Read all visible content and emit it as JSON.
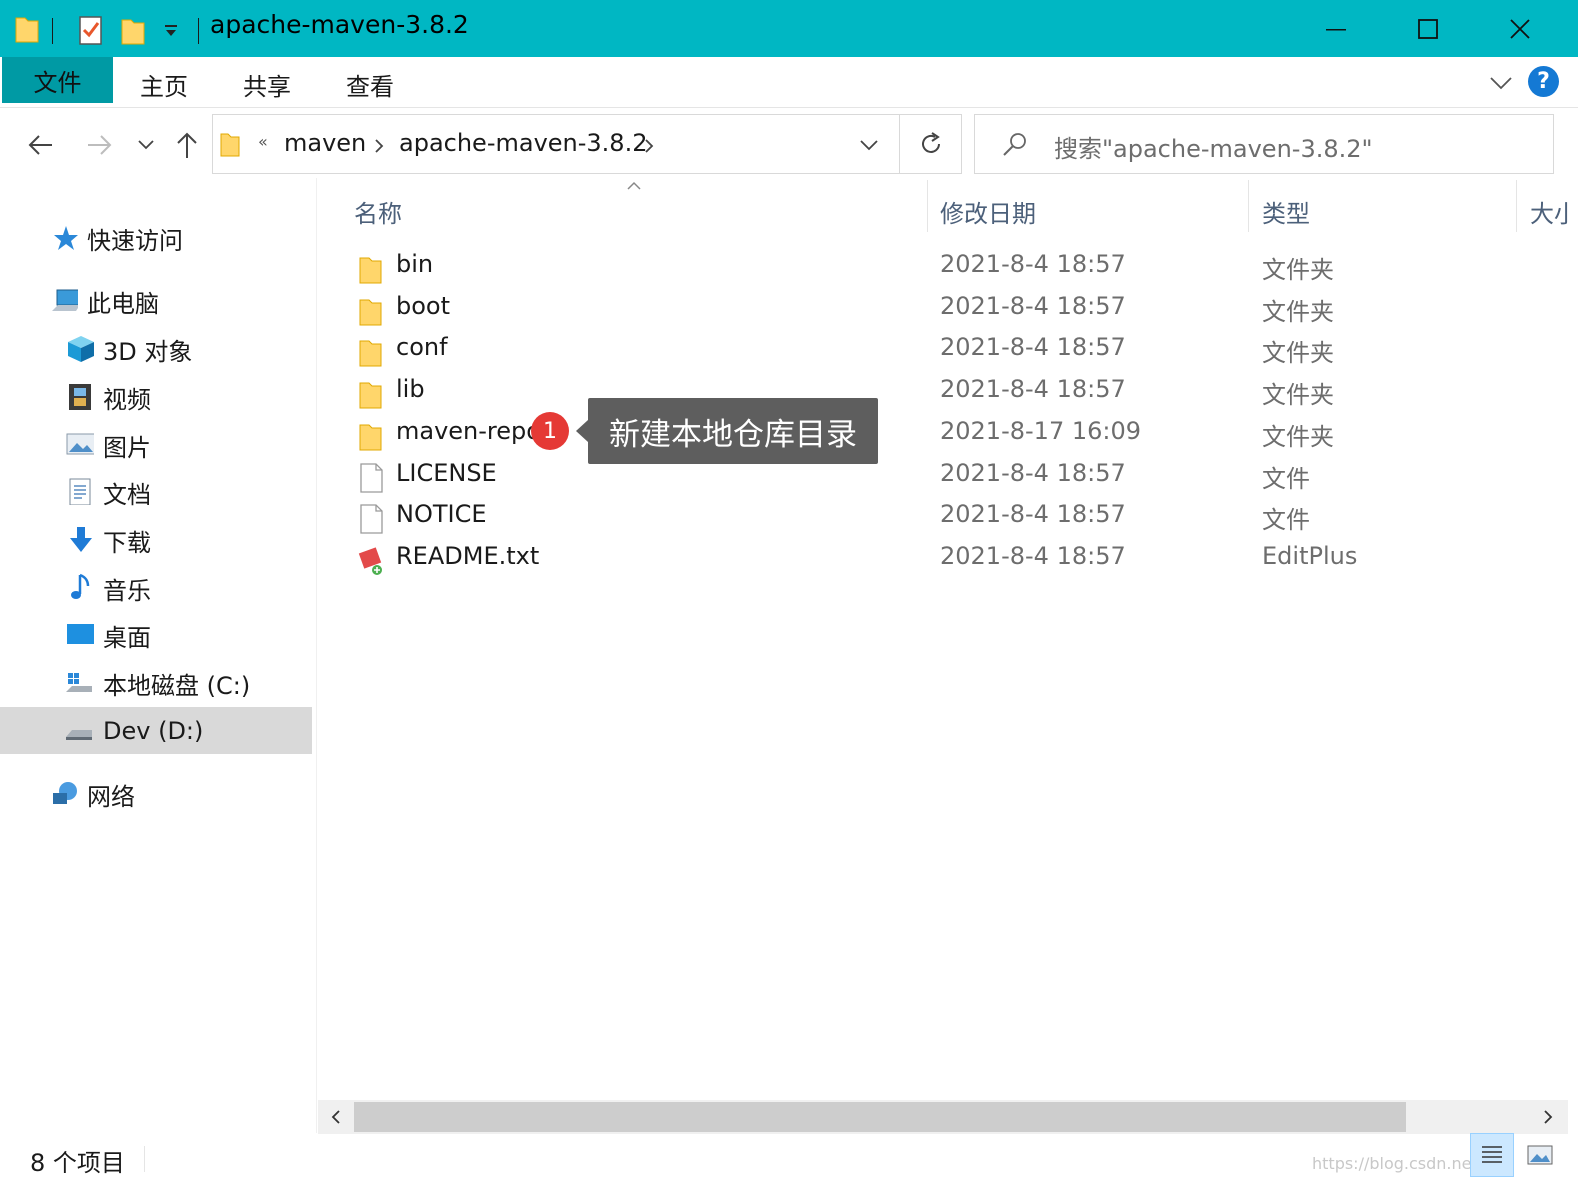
{
  "window": {
    "title": "apache-maven-3.8.2",
    "accent_color": "#00b7c3",
    "active_tab_color": "#009aa4"
  },
  "ribbon": {
    "tabs": [
      "文件",
      "主页",
      "共享",
      "查看"
    ],
    "help_label": "?"
  },
  "address": {
    "overflow": "«",
    "crumbs": [
      "maven",
      "apache-maven-3.8.2"
    ],
    "search_placeholder": "搜索\"apache-maven-3.8.2\""
  },
  "sidebar": {
    "items": [
      {
        "label": "快速访问",
        "icon": "star-icon"
      },
      {
        "label": "此电脑",
        "icon": "computer-icon"
      },
      {
        "label": "3D 对象",
        "icon": "cube-icon"
      },
      {
        "label": "视频",
        "icon": "film-icon"
      },
      {
        "label": "图片",
        "icon": "picture-icon"
      },
      {
        "label": "文档",
        "icon": "document-icon"
      },
      {
        "label": "下载",
        "icon": "download-arrow-icon"
      },
      {
        "label": "音乐",
        "icon": "music-note-icon"
      },
      {
        "label": "桌面",
        "icon": "desktop-icon"
      },
      {
        "label": "本地磁盘 (C:)",
        "icon": "windows-drive-icon"
      },
      {
        "label": "Dev (D:)",
        "icon": "drive-icon"
      },
      {
        "label": "网络",
        "icon": "network-icon"
      }
    ]
  },
  "columns": {
    "name": "名称",
    "date": "修改日期",
    "type": "类型",
    "size": "大小"
  },
  "files": [
    {
      "name": "bin",
      "date": "2021-8-4 18:57",
      "type": "文件夹",
      "icon": "folder-icon"
    },
    {
      "name": "boot",
      "date": "2021-8-4 18:57",
      "type": "文件夹",
      "icon": "folder-icon"
    },
    {
      "name": "conf",
      "date": "2021-8-4 18:57",
      "type": "文件夹",
      "icon": "folder-icon"
    },
    {
      "name": "lib",
      "date": "2021-8-4 18:57",
      "type": "文件夹",
      "icon": "folder-icon"
    },
    {
      "name": "maven-repo",
      "date": "2021-8-17 16:09",
      "type": "文件夹",
      "icon": "folder-icon"
    },
    {
      "name": "LICENSE",
      "date": "2021-8-4 18:57",
      "type": "文件",
      "icon": "file-icon"
    },
    {
      "name": "NOTICE",
      "date": "2021-8-4 18:57",
      "type": "文件",
      "icon": "file-icon"
    },
    {
      "name": "README.txt",
      "date": "2021-8-4 18:57",
      "type": "EditPlus",
      "icon": "editplus-icon"
    }
  ],
  "annotation": {
    "badge": "1",
    "tooltip": "新建本地仓库目录"
  },
  "status": {
    "item_count": "8 个项目",
    "watermark": "https://blog.csdn.net/m..."
  }
}
